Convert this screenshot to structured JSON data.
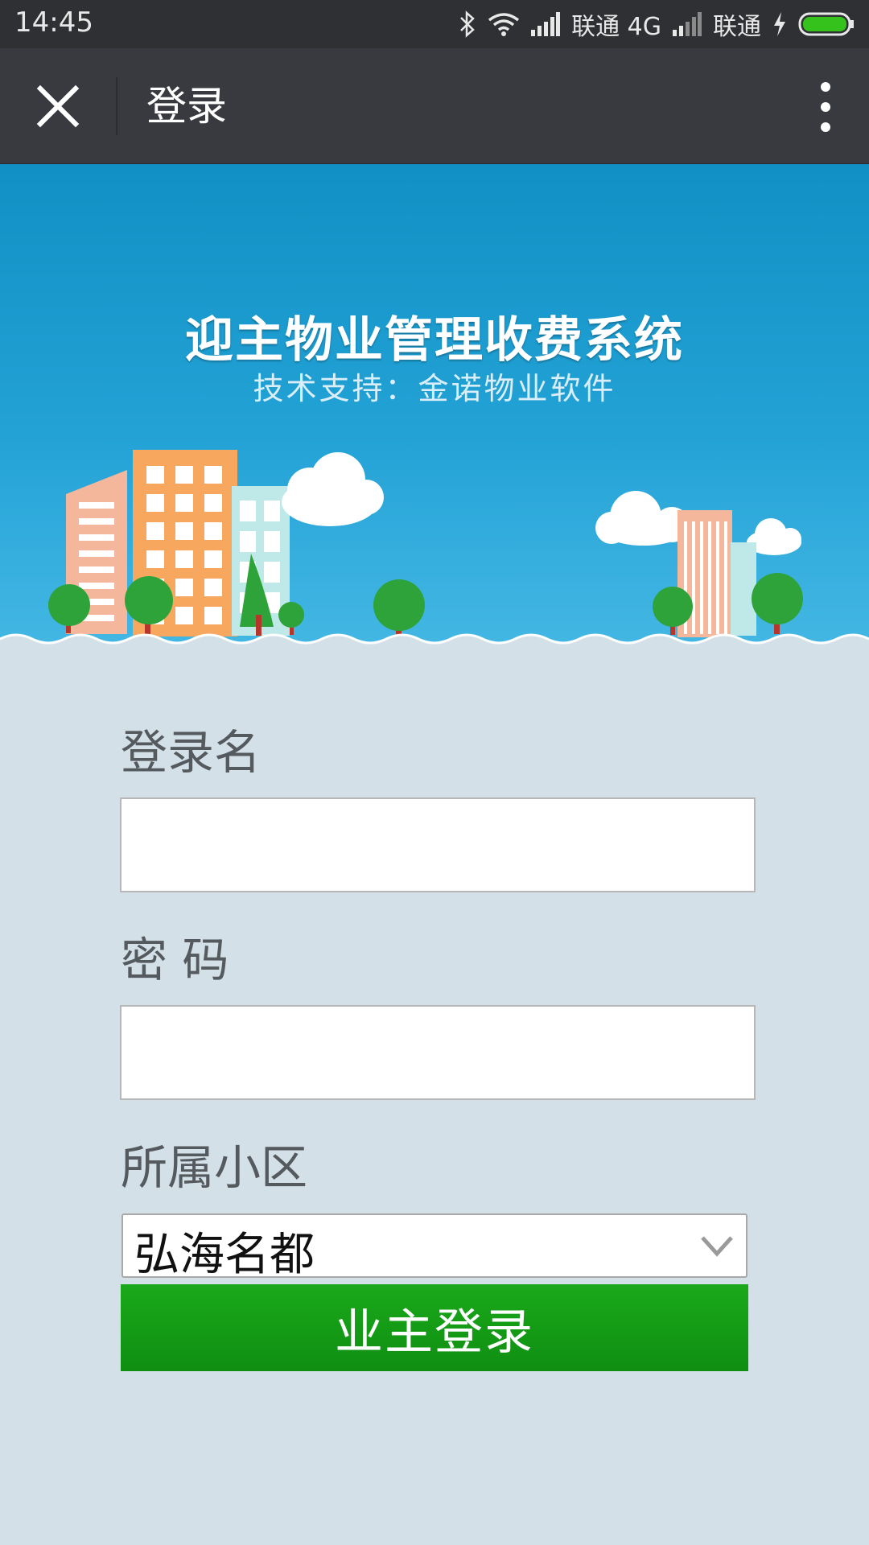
{
  "status_bar": {
    "time": "14:45",
    "carrier_1": "联通 4G",
    "carrier_2": "联通",
    "icons": [
      "bluetooth-icon",
      "wifi-icon",
      "signal-icon",
      "charging-icon",
      "battery-icon"
    ]
  },
  "nav": {
    "title": "登录",
    "close_icon": "close-icon",
    "more_icon": "more-vertical-icon"
  },
  "banner": {
    "title": "迎主物业管理收费系统",
    "subtitle": "技术支持：金诺物业软件"
  },
  "form": {
    "username_label": "登录名",
    "username_value": "",
    "password_label": "密 码",
    "password_value": "",
    "community_label": "所属小区",
    "community_selected": "弘海名都",
    "login_button": "业主登录"
  },
  "colors": {
    "status_bar": "#2f3033",
    "nav_bar": "#393a3f",
    "page_background": "#d3e0e8",
    "banner_sky": "#23a2d6",
    "button_green": "#13a014"
  }
}
